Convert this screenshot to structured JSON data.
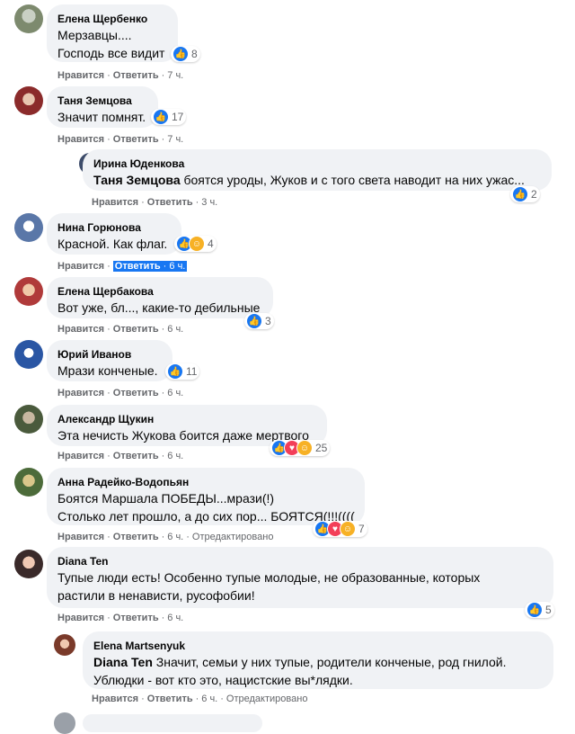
{
  "comments": [
    {
      "author": "Елена Щербенко",
      "lines": [
        "Мерзавцы....",
        "Господь все видит"
      ],
      "reactions": {
        "icons": [
          "like"
        ],
        "count": "8"
      },
      "actions": {
        "like": "Нравится",
        "reply": "Ответить",
        "time": "7 ч."
      }
    },
    {
      "author": "Таня Земцова",
      "lines": [
        "Значит помнят."
      ],
      "reactions": {
        "icons": [
          "like"
        ],
        "count": "17"
      },
      "actions": {
        "like": "Нравится",
        "reply": "Ответить",
        "time": "7 ч."
      }
    },
    {
      "author": "Ирина Юденкова",
      "mention": "Таня Земцова",
      "lines": [
        "боятся уроды, Жуков и с того света наводит на них ужас..."
      ],
      "reactions": {
        "icons": [
          "like"
        ],
        "count": "2"
      },
      "actions": {
        "like": "Нравится",
        "reply": "Ответить",
        "time": "3 ч."
      }
    },
    {
      "author": "Нина Горюнова",
      "lines": [
        "Красной. Как флаг."
      ],
      "reactions": {
        "icons": [
          "like",
          "care"
        ],
        "count": "4"
      },
      "actions": {
        "like": "Нравится",
        "reply": "Ответить",
        "time": "6 ч."
      }
    },
    {
      "author": "Елена Щербакова",
      "lines": [
        "Вот уже, бл..., какие-то дебильные"
      ],
      "reactions": {
        "icons": [
          "like"
        ],
        "count": "3"
      },
      "actions": {
        "like": "Нравится",
        "reply": "Ответить",
        "time": "6 ч."
      }
    },
    {
      "author": "Юрий Иванов",
      "lines": [
        "Мрази конченые."
      ],
      "reactions": {
        "icons": [
          "like"
        ],
        "count": "11"
      },
      "actions": {
        "like": "Нравится",
        "reply": "Ответить",
        "time": "6 ч."
      }
    },
    {
      "author": "Александр Щукин",
      "lines": [
        "Эта нечисть Жукова боится даже мертвого"
      ],
      "reactions": {
        "icons": [
          "like",
          "love",
          "care"
        ],
        "count": "25"
      },
      "actions": {
        "like": "Нравится",
        "reply": "Ответить",
        "time": "6 ч."
      }
    },
    {
      "author": "Анна Радейко-Водопьян",
      "lines": [
        "Боятся Маршала ПОБЕДЫ...мрази(!)",
        "Столько лет прошло, а до сих пор... БОЯТСЯ(!!!(((("
      ],
      "reactions": {
        "icons": [
          "like",
          "love",
          "care"
        ],
        "count": "7"
      },
      "actions": {
        "like": "Нравится",
        "reply": "Ответить",
        "time": "6 ч.",
        "edited": "Отредактировано"
      }
    },
    {
      "author": "Diana Ten",
      "lines": [
        "Тупые люди есть! Особенно тупые молодые, не образованные, которых",
        "растили в ненависти, русофобии!"
      ],
      "reactions": {
        "icons": [
          "like"
        ],
        "count": "5"
      },
      "actions": {
        "like": "Нравится",
        "reply": "Ответить",
        "time": "6 ч."
      }
    },
    {
      "author": "Elena Martsenyuk",
      "mention": "Diana Ten",
      "lines": [
        "Значит, семьи у них тупые, родители конченые, род гнилой.",
        "Ублюдки - вот кто это, нацистские вы*лядки."
      ],
      "reactions": null,
      "actions": {
        "like": "Нравится",
        "reply": "Ответить",
        "time": "6 ч.",
        "edited": "Отредактировано"
      }
    }
  ],
  "colors": {
    "bubble": "#f0f2f5",
    "meta": "#65676b",
    "like": "#1877f2",
    "love": "#f33e58",
    "care": "#f7b125",
    "selection": "#1877f2"
  }
}
